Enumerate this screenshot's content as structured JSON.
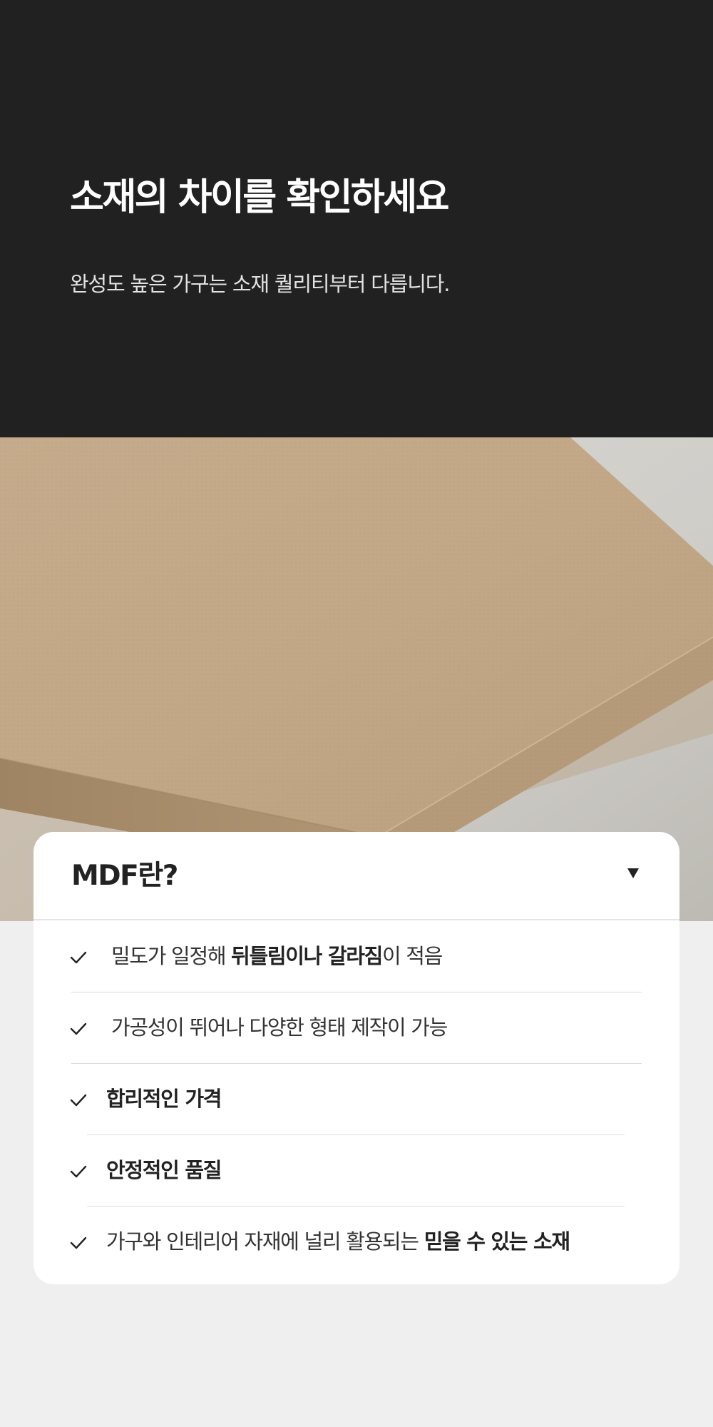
{
  "hero": {
    "title": "소재의 차이를 확인하세요",
    "subtitle": "완성도 높은 가구는 소재 퀄리티부터 다릅니다."
  },
  "photo": {
    "subject": "mdf-board-icon",
    "colors": {
      "board_top": "#c2a888",
      "board_edge": "#a98e6c",
      "backdrop": "#d3d1cc"
    }
  },
  "card": {
    "title": "MDF란?",
    "toggle_icon": "triangle-down-icon",
    "items": [
      {
        "pre": "밀도가 일정해 ",
        "bold": "뒤틀림이나 갈라짐",
        "post": "이 적음"
      },
      {
        "pre": "가공성이 뛰어나 다양한 형태 제작이 가능",
        "bold": "",
        "post": ""
      },
      {
        "pre": "",
        "bold": "합리적인 가격",
        "post": ""
      },
      {
        "pre": "",
        "bold": "안정적인 품질",
        "post": ""
      },
      {
        "pre": "가구와 인테리어 자재에 널리 활용되는 ",
        "bold": "믿을 수 있는 소재",
        "post": ""
      }
    ]
  },
  "colors": {
    "hero_bg": "#212121",
    "page_bg": "#efefef",
    "card_bg": "#ffffff",
    "text_dark": "#222222"
  }
}
